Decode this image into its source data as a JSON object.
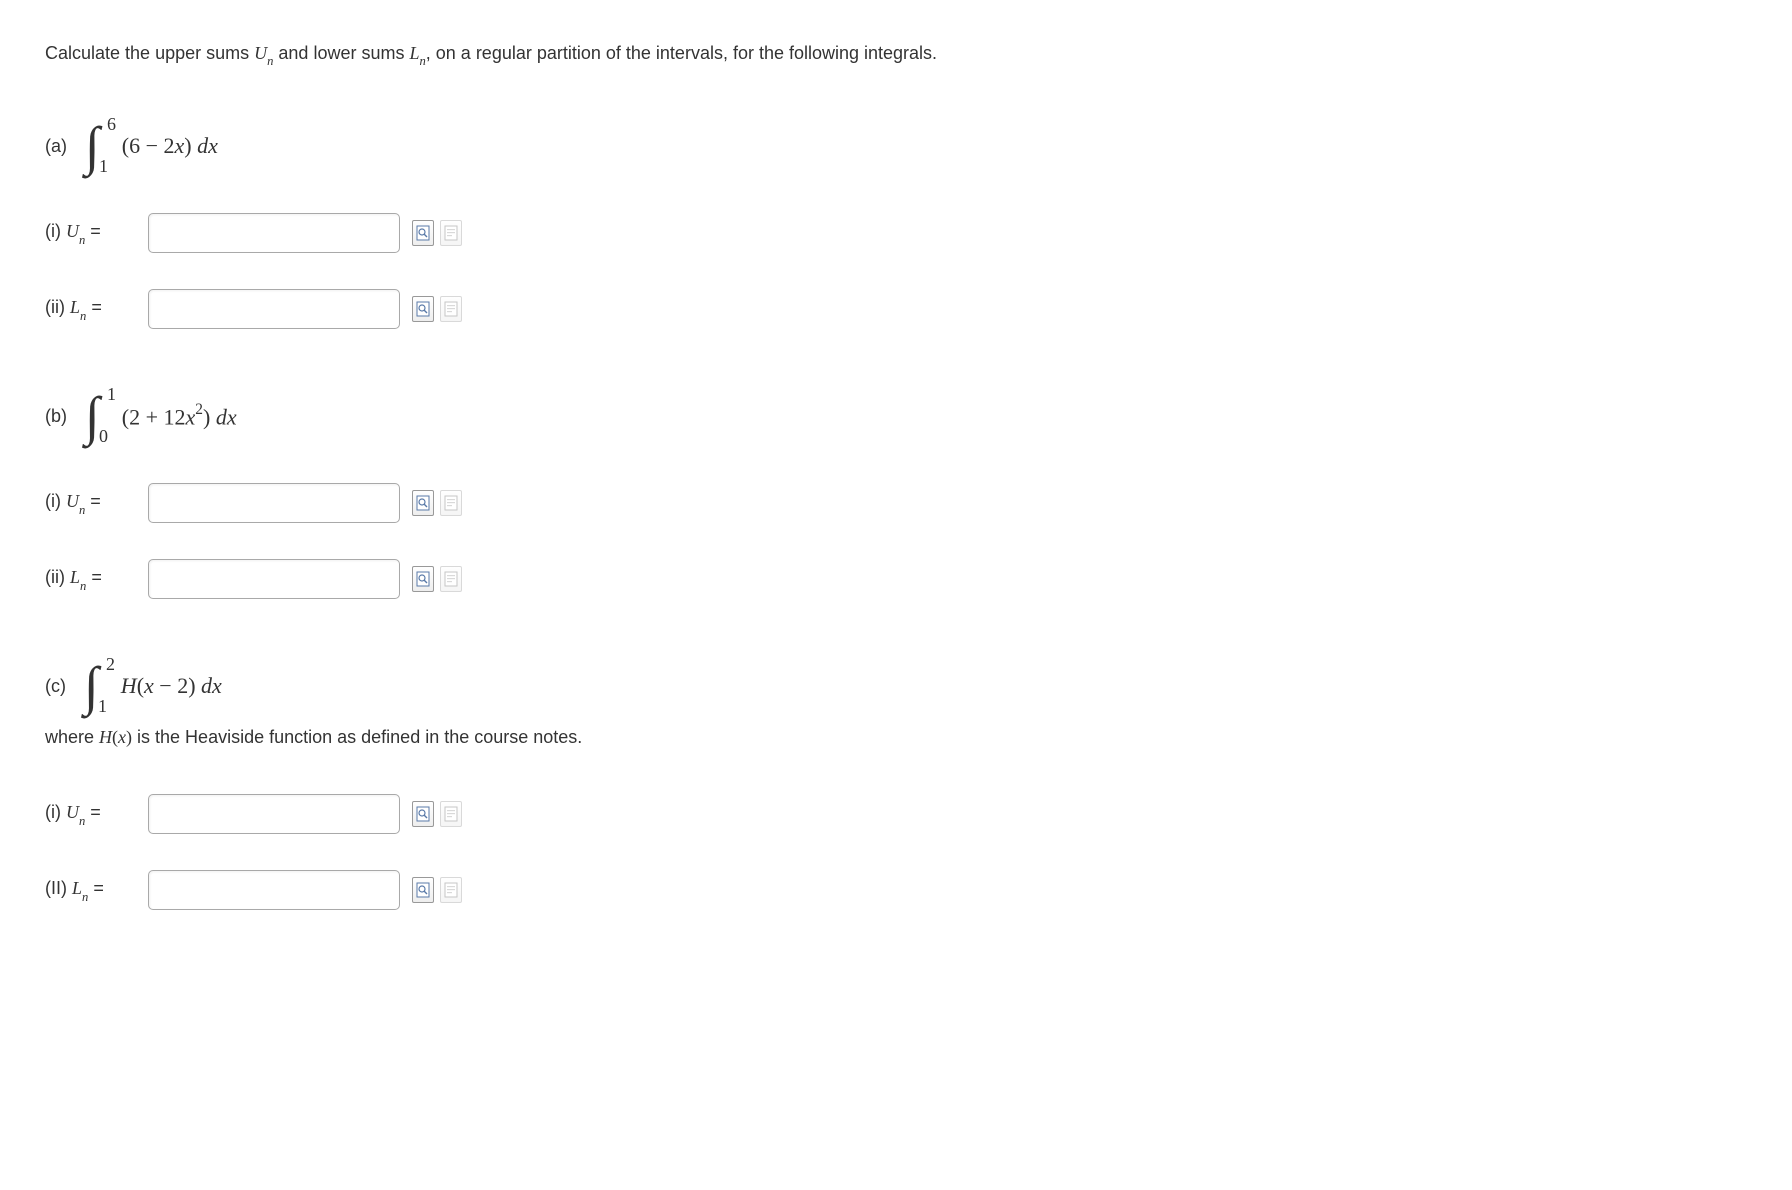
{
  "intro": {
    "prefix": "Calculate the upper sums ",
    "Un": "U",
    "Un_sub": "n",
    "mid1": " and lower sums ",
    "Ln": "L",
    "Ln_sub": "n",
    "suffix": ", on a regular partition of the intervals, for the following integrals."
  },
  "parts": {
    "a": {
      "label": "(a)",
      "int_upper": "6",
      "int_lower": "1",
      "integrand_open": "(6 − 2",
      "integrand_x": "x",
      "integrand_close": ") ",
      "d": "d",
      "x2": "x",
      "rows": {
        "i_label_pre": "(i) ",
        "i_U": "U",
        "i_n": "n",
        "i_eq": " =",
        "ii_label_pre": "(ii) ",
        "ii_L": "L",
        "ii_n": "n",
        "ii_eq": " ="
      }
    },
    "b": {
      "label": "(b)",
      "int_upper": "1",
      "int_lower": "0",
      "integrand_open": "(2 + 12",
      "integrand_x": "x",
      "integrand_sup": "2",
      "integrand_close": ") ",
      "d": "d",
      "x2": "x",
      "rows": {
        "i_label_pre": "(i) ",
        "i_U": "U",
        "i_n": "n",
        "i_eq": " =",
        "ii_label_pre": "(ii) ",
        "ii_L": "L",
        "ii_n": "n",
        "ii_eq": " ="
      }
    },
    "c": {
      "label": "(c)",
      "int_upper": "2",
      "int_lower": "1",
      "integrand_H": "H",
      "integrand_open": "(",
      "integrand_x": "x",
      "integrand_mid": " − 2) ",
      "d": "d",
      "x2": "x",
      "note_pre": "where ",
      "note_H": "H",
      "note_open": "(",
      "note_x": "x",
      "note_close": ")",
      "note_suffix": " is the Heaviside function as defined in the course notes.",
      "rows": {
        "i_label_pre": "(i) ",
        "i_U": "U",
        "i_n": "n",
        "i_eq": " =",
        "ii_label_pre": "(II) ",
        "ii_L": "L",
        "ii_n": "n",
        "ii_eq": " ="
      }
    }
  }
}
